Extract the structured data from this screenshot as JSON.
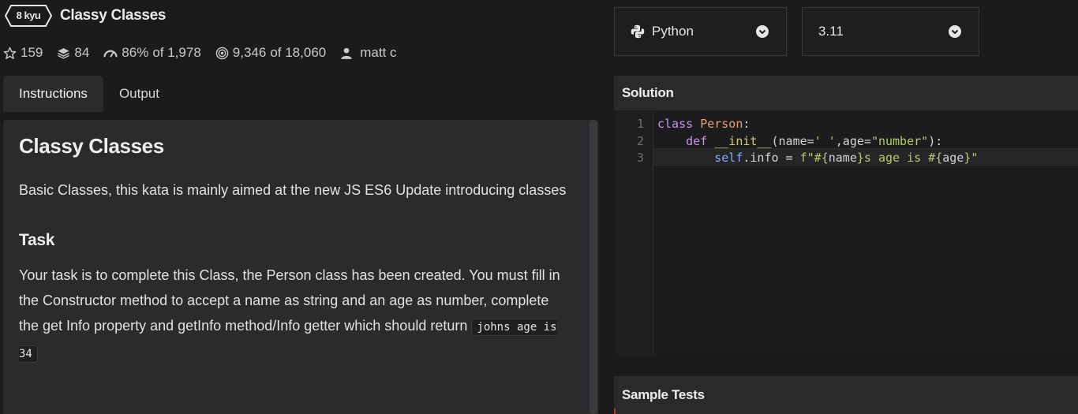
{
  "kata": {
    "rank": "8 kyu",
    "title": "Classy Classes"
  },
  "stats": {
    "stars": "159",
    "collections": "84",
    "satisfaction": "86%",
    "satisfaction_of": "of 1,978",
    "completed": "9,346",
    "completed_of": "of 18,060",
    "author": "matt c"
  },
  "tabs": [
    {
      "label": "Instructions",
      "active": true
    },
    {
      "label": "Output",
      "active": false
    }
  ],
  "instructions": {
    "heading": "Classy Classes",
    "intro": "Basic Classes, this kata is mainly aimed at the new JS ES6 Update introducing classes",
    "task_heading": "Task",
    "task_text": "Your task is to complete this Class, the Person class has been created. You must fill in the Constructor method to accept a name as string and an age as number, complete the get Info property and getInfo method/Info getter which should return",
    "task_code": "johns age is 34"
  },
  "language_select": {
    "value": "Python",
    "icon": "python-icon"
  },
  "version_select": {
    "value": "3.11"
  },
  "solution": {
    "title": "Solution",
    "line_numbers": [
      "1",
      "2",
      "3"
    ],
    "lines": [
      [
        "class",
        " ",
        "Person",
        ":"
      ],
      [
        "    ",
        "def",
        " ",
        "__init__",
        "(name=",
        "' '",
        ",age=",
        "\"number\"",
        "):"
      ],
      [
        "        ",
        "self",
        ".info = ",
        "f\"#{",
        "name",
        "}s age is #{",
        "age",
        "}\""
      ]
    ]
  },
  "sample_tests": {
    "title": "Sample Tests"
  },
  "colors": {
    "background": "#1b1b1c",
    "panel": "#2b2b2e",
    "editor_bg": "#1c1c1e",
    "keyword": "#c792ea",
    "class_name": "#e8a26b",
    "function_name": "#d7cd6a",
    "string": "#b5cc67",
    "self": "#82aaff"
  }
}
